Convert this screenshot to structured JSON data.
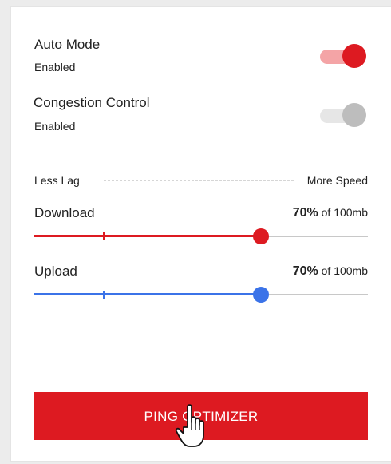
{
  "auto_mode": {
    "title": "Auto Mode",
    "status": "Enabled",
    "on": true
  },
  "congestion": {
    "title": "Congestion Control",
    "status": "Enabled",
    "on": false
  },
  "scale": {
    "left": "Less Lag",
    "right": "More Speed"
  },
  "download": {
    "label": "Download",
    "percent_text": "70%",
    "of_text": "of 100mb",
    "level": 0.68
  },
  "upload": {
    "label": "Upload",
    "percent_text": "70%",
    "of_text": "of 100mb",
    "level": 0.68
  },
  "cta": {
    "label": "PING OPTIMIZER"
  },
  "colors": {
    "accent_red": "#dd1a21",
    "track_red": "#f4a4a6",
    "knob_grey": "#bdbdbd",
    "track_grey": "#e6e6e6",
    "accent_blue": "#3b73e8"
  },
  "icons": {
    "cursor": "hand-pointer-icon"
  }
}
